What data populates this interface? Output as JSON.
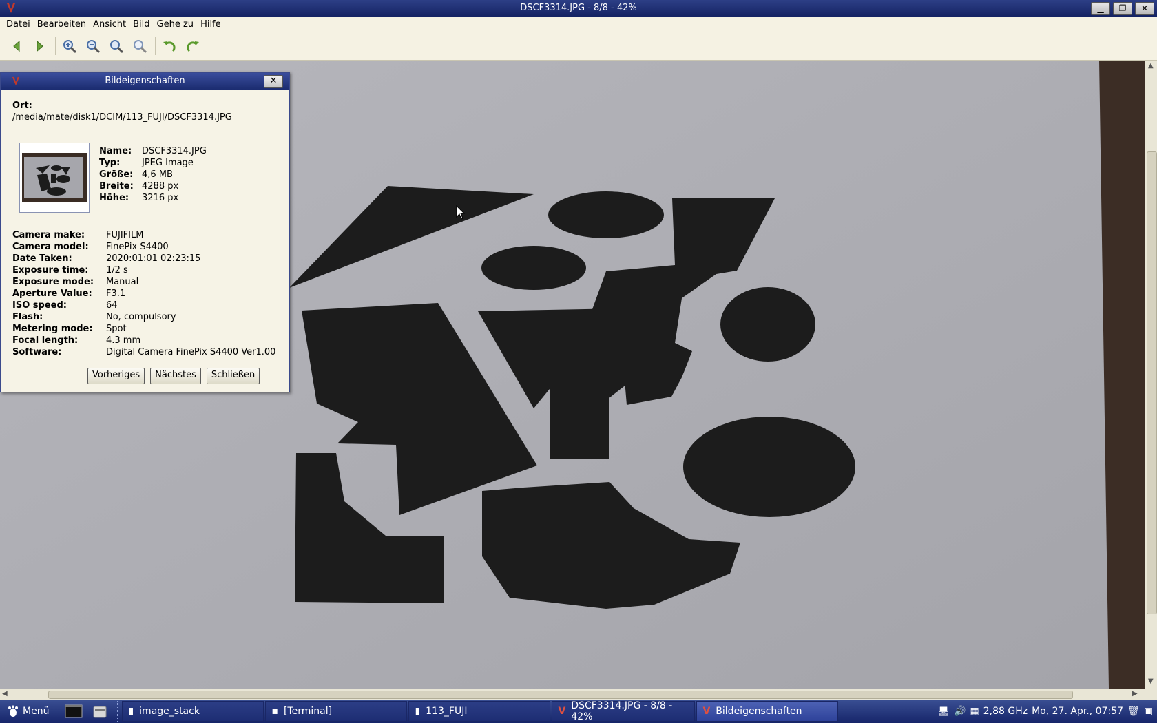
{
  "window": {
    "title": "DSCF3314.JPG - 8/8 - 42%"
  },
  "menubar": {
    "items": [
      "Datei",
      "Bearbeiten",
      "Ansicht",
      "Bild",
      "Gehe zu",
      "Hilfe"
    ]
  },
  "toolbar": {
    "icons": [
      "arrow-left-icon",
      "arrow-right-icon",
      "zoom-in-icon",
      "zoom-out-icon",
      "zoom-fit-icon",
      "zoom-original-icon",
      "rotate-left-icon",
      "rotate-right-icon"
    ]
  },
  "dialog": {
    "title": "Bildeigenschaften",
    "close_glyph": "✕",
    "location_label": "Ort:",
    "location_path": "/media/mate/disk1/DCIM/113_FUJI/DSCF3314.JPG",
    "basic": [
      {
        "key": "Name:",
        "value": "DSCF3314.JPG"
      },
      {
        "key": "Typ:",
        "value": "JPEG Image"
      },
      {
        "key": "Größe:",
        "value": "4,6 MB"
      },
      {
        "key": "Breite:",
        "value": "4288 px"
      },
      {
        "key": "Höhe:",
        "value": "3216 px"
      }
    ],
    "exif": [
      {
        "key": "Camera make:",
        "value": "FUJIFILM"
      },
      {
        "key": "Camera model:",
        "value": "FinePix S4400"
      },
      {
        "key": "Date Taken:",
        "value": "2020:01:01 02:23:15"
      },
      {
        "key": "Exposure time:",
        "value": "1/2 s"
      },
      {
        "key": "Exposure mode:",
        "value": "Manual"
      },
      {
        "key": "Aperture Value:",
        "value": "F3.1"
      },
      {
        "key": "ISO speed:",
        "value": "64"
      },
      {
        "key": "Flash:",
        "value": "No, compulsory"
      },
      {
        "key": "Metering mode:",
        "value": "Spot"
      },
      {
        "key": "Focal length:",
        "value": "4.3 mm"
      },
      {
        "key": "Software:",
        "value": "Digital Camera FinePix S4400 Ver1.00"
      }
    ],
    "buttons": {
      "prev": "Vorheriges",
      "next": "Nächstes",
      "close": "Schließen"
    }
  },
  "taskbar": {
    "menu_label": "Menü",
    "tasks": [
      {
        "label": "image_stack",
        "active": false
      },
      {
        "label": "[Terminal]",
        "active": false
      },
      {
        "label": "113_FUJI",
        "active": false
      },
      {
        "label": "DSCF3314.JPG - 8/8 - 42%",
        "active": false
      },
      {
        "label": "Bildeigenschaften",
        "active": true
      }
    ],
    "cpu": "2,88 GHz",
    "clock": "Mo, 27. Apr., 07:57"
  },
  "colors": {
    "titlebar": "#1b2c70",
    "accent": "#2e429a",
    "paper": "#a9a9b0",
    "shape": "#1c1c1c"
  }
}
